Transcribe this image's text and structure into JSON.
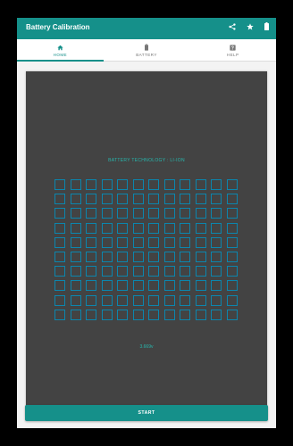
{
  "app": {
    "title": "Battery Calibration",
    "accent_color": "#15908a",
    "actions": [
      {
        "name": "share-icon"
      },
      {
        "name": "star-icon"
      },
      {
        "name": "battery-icon"
      }
    ]
  },
  "tabs": [
    {
      "label": "HOME",
      "icon": "home-icon",
      "active": true
    },
    {
      "label": "BATTERY",
      "icon": "battery-icon",
      "active": false
    },
    {
      "label": "HELP",
      "icon": "help-icon",
      "active": false
    }
  ],
  "main": {
    "technology_label": "BATTERY TECHNOLOGY :  LI-ION",
    "voltage": "3.669v",
    "grid": {
      "rows": 10,
      "cols": 12,
      "cell_color": "#0b86ae"
    },
    "start_label": "START"
  }
}
